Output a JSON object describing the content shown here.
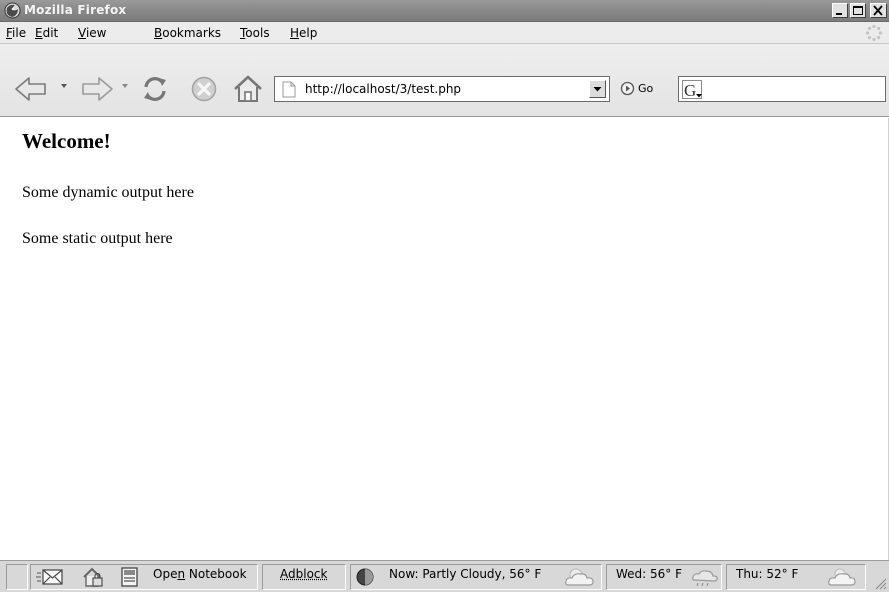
{
  "window": {
    "title": "Mozilla Firefox",
    "icons": [
      "firefox-icon",
      "minimize-icon",
      "maximize-icon",
      "close-icon"
    ]
  },
  "menu": {
    "items": [
      {
        "label": "File",
        "accesskey": "F",
        "rest": "ile"
      },
      {
        "label": "Edit",
        "accesskey": "E",
        "rest": "dit"
      },
      {
        "label": "View",
        "accesskey": "V",
        "rest": "iew"
      },
      {
        "label": "Bookmarks",
        "accesskey": "B",
        "rest": "ookmarks"
      },
      {
        "label": "Tools",
        "accesskey": "T",
        "rest": "ools"
      },
      {
        "label": "Help",
        "accesskey": "H",
        "rest": "elp"
      }
    ]
  },
  "toolbar": {
    "icons": [
      "back-icon",
      "forward-icon",
      "reload-icon",
      "stop-icon",
      "home-icon",
      "go-icon"
    ],
    "url": "http://localhost/3/test.php",
    "go_label": "Go",
    "search_engine": "G",
    "search_value": ""
  },
  "page": {
    "heading": "Welcome!",
    "line1": "Some dynamic output here",
    "line2": "Some static output here"
  },
  "status": {
    "icons": [
      "mail-icon",
      "house-lock-icon",
      "notebook-icon",
      "weather-status-icon",
      "cloud-icon"
    ],
    "open_notebook_pre": "Ope",
    "open_notebook_key": "n",
    "open_notebook_post": " Notebook",
    "adblock": "Adblock",
    "now": "Now: Partly Cloudy, 56° F",
    "wed": "Wed: 56° F",
    "thu": "Thu: 52° F"
  },
  "colors": {
    "titlebar": "#8a8a8a",
    "menubar": "#ececec",
    "toolbar": "#e6e6e6",
    "statusbar": "#d8d8d8"
  }
}
